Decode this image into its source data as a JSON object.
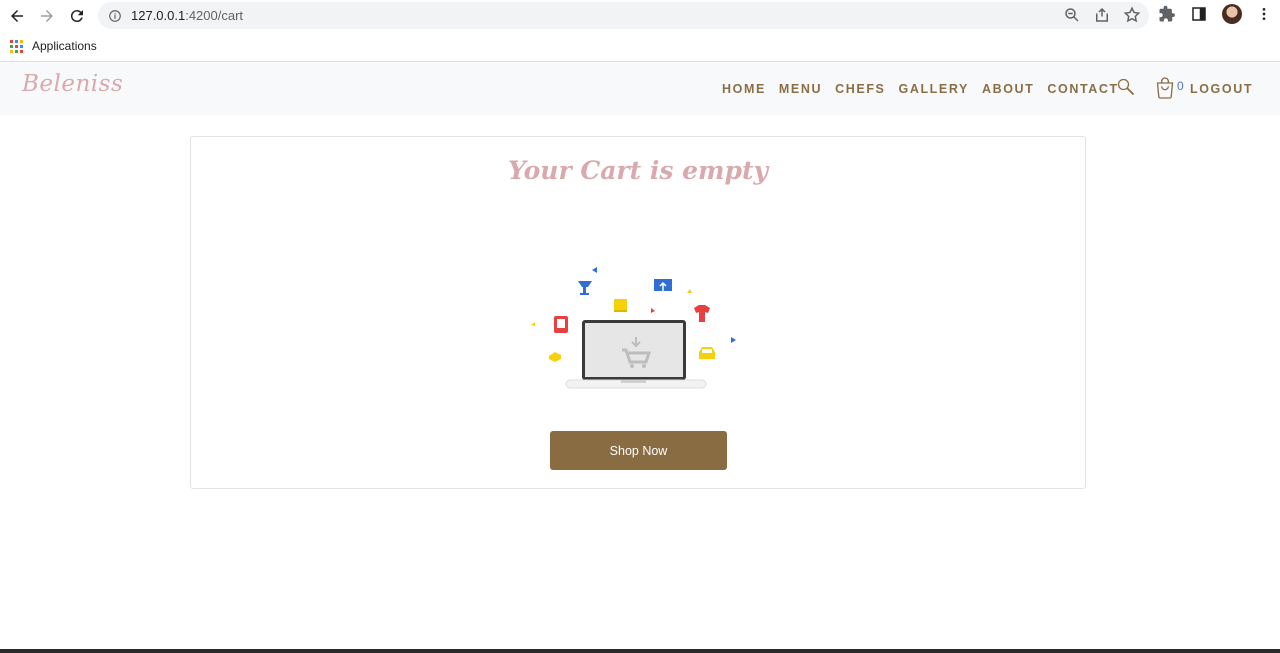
{
  "browser": {
    "url_host": "127.0.0.1",
    "url_path": ":4200/cart",
    "bookmark_label": "Applications"
  },
  "header": {
    "brand": "Beleniss",
    "nav": [
      "HOME",
      "MENU",
      "CHEFS",
      "GALLERY",
      "ABOUT",
      "CONTACT"
    ],
    "cart_count": "0",
    "logout": "LOGOUT"
  },
  "cart": {
    "title": "Your Cart is empty",
    "button": "Shop Now"
  },
  "colors": {
    "brand_pink": "#d9a9ad",
    "nav_brown": "#8a6e46",
    "button_brown": "#8a6c42"
  },
  "icons": [
    "back-arrow-icon",
    "forward-arrow-icon",
    "reload-icon",
    "info-icon",
    "zoom-icon",
    "share-icon",
    "star-icon",
    "extensions-icon",
    "side-panel-icon",
    "menu-dots-icon",
    "apps-icon",
    "search-icon",
    "shopping-bag-icon"
  ]
}
